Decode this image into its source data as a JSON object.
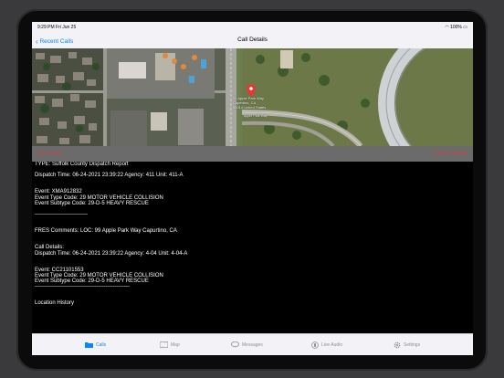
{
  "status_bar": {
    "time": "9:29 PM  Fri Jun 25",
    "battery": "100%"
  },
  "nav": {
    "back_label": "Recent Calls",
    "title": "Call Details"
  },
  "map": {
    "pin_label_1": "99 Apple Park Way",
    "pin_label_2": "Cupertino, CA",
    "pin_label_3": "95014 United States",
    "street_label": "Apple Park Way"
  },
  "info_bar": {
    "left": "3.5 mi away",
    "right": "9 min to location"
  },
  "details": {
    "lines": [
      "TYPE: Suffolk County Dispatch Report",
      "",
      "Dispatch Time: 06-24-2021 23:39:22 Agency: 411 Unit: 411-A",
      "",
      "",
      "Event: XMA912832",
      "Event Type Code: 29 MOTOR VEHICLE COLLISION",
      "Event Subtype Code: 29-D-5 HEAVY RESCUE",
      "",
      "-----------------------------",
      "",
      "",
      "FRES Comments: LOC: 99 Apple Park Way  Capurtino, CA",
      "",
      "",
      " Call Details:",
      "Dispatch Time: 06-24-2021 23:39:22 Agency: 4-04 Unit: 4-04-A",
      "",
      "",
      "Event: CC21101553",
      "Event Type Code: 29 MOTOR VEHICLE COLLISION",
      "Event Subtype Code: 29-D-5 HEAVY RESCUE",
      "----------------------------------------------------",
      "",
      "",
      "Location History"
    ]
  },
  "tabs": [
    {
      "label": "Calls",
      "icon": "folder-icon"
    },
    {
      "label": "Map",
      "icon": "map-icon"
    },
    {
      "label": "Messages",
      "icon": "message-bubble-icon"
    },
    {
      "label": "Live Audio",
      "icon": "audio-icon"
    },
    {
      "label": "Settings",
      "icon": "gear-icon"
    }
  ],
  "colors": {
    "accent": "#0a84ff",
    "alert": "#e53935",
    "pin": "#e53935"
  }
}
